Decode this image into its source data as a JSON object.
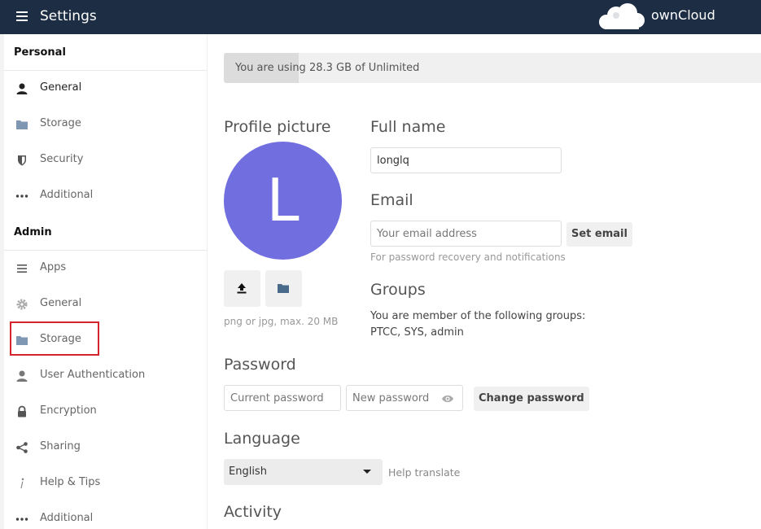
{
  "header": {
    "app_title": "Settings",
    "brand": "ownCloud",
    "menu_icon": "hamburger-icon",
    "logo_icon": "cloud-logo-icon",
    "background": "#1d2d44"
  },
  "sidebar": {
    "personal_heading": "Personal",
    "admin_heading": "Admin",
    "personal_items": [
      {
        "label": "General",
        "icon": "user-icon"
      },
      {
        "label": "Storage",
        "icon": "folder-icon"
      },
      {
        "label": "Security",
        "icon": "shield-icon"
      },
      {
        "label": "Additional",
        "icon": "more-icon"
      }
    ],
    "admin_items": [
      {
        "label": "Apps",
        "icon": "list-icon"
      },
      {
        "label": "General",
        "icon": "gear-icon"
      },
      {
        "label": "Storage",
        "icon": "folder-icon",
        "highlighted": true
      },
      {
        "label": "User Authentication",
        "icon": "user-icon"
      },
      {
        "label": "Encryption",
        "icon": "lock-icon"
      },
      {
        "label": "Sharing",
        "icon": "share-icon"
      },
      {
        "label": "Help & Tips",
        "icon": "info-icon"
      },
      {
        "label": "Additional",
        "icon": "more-icon"
      }
    ],
    "highlight_color": "#d6242d"
  },
  "quota": {
    "text": "You are using 28.3 GB of Unlimited",
    "fill_fraction": 0.14
  },
  "profile": {
    "heading": "Profile picture",
    "avatar_letter": "L",
    "avatar_color": "#716fe0",
    "upload_icon": "upload-icon",
    "choose_icon": "folder-icon",
    "hint": "png or jpg, max. 20 MB"
  },
  "fullname": {
    "heading": "Full name",
    "value": "longlq"
  },
  "email": {
    "heading": "Email",
    "placeholder": "Your email address",
    "button": "Set email",
    "hint": "For password recovery and notifications"
  },
  "groups": {
    "heading": "Groups",
    "intro": "You are member of the following groups:",
    "list": "PTCC, SYS, admin"
  },
  "password": {
    "heading": "Password",
    "current_placeholder": "Current password",
    "new_placeholder": "New password",
    "eye_icon": "eye-icon",
    "button": "Change password"
  },
  "language": {
    "heading": "Language",
    "selected": "English",
    "help_link": "Help translate"
  },
  "activity": {
    "heading": "Activity"
  }
}
